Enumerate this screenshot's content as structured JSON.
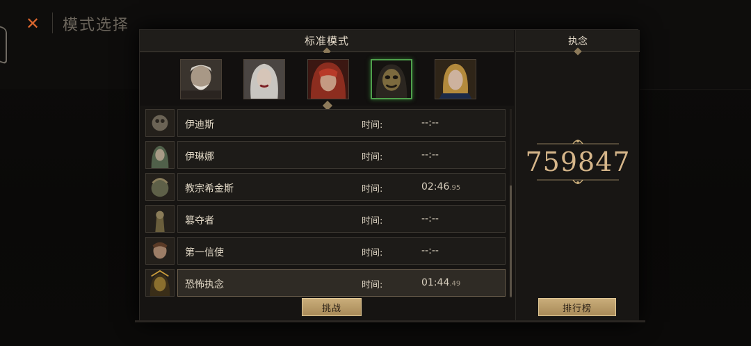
{
  "background": {
    "title": "模式选择",
    "close_icon": "close-icon"
  },
  "mode": {
    "title": "标准模式",
    "portraits": [
      {
        "name": "portrait-old-man",
        "selected": false
      },
      {
        "name": "portrait-silver-hair-woman",
        "selected": false
      },
      {
        "name": "portrait-red-hood-woman",
        "selected": false
      },
      {
        "name": "portrait-masked-figure",
        "selected": true
      },
      {
        "name": "portrait-blonde-woman",
        "selected": false
      }
    ],
    "bosses": [
      {
        "name": "伊迪斯",
        "time_label": "时间:",
        "time": "--:--",
        "ms": ""
      },
      {
        "name": "伊琳娜",
        "time_label": "时间:",
        "time": "--:--",
        "ms": ""
      },
      {
        "name": "教宗希金斯",
        "time_label": "时间:",
        "time": "02:46",
        "ms": ".95"
      },
      {
        "name": "篡夺者",
        "time_label": "时间:",
        "time": "--:--",
        "ms": ""
      },
      {
        "name": "第一信使",
        "time_label": "时间:",
        "time": "--:--",
        "ms": ""
      },
      {
        "name": "恐怖执念",
        "time_label": "时间:",
        "time": "01:44",
        "ms": ".49"
      }
    ],
    "challenge_label": "挑战"
  },
  "obsession": {
    "title": "执念",
    "score": "759847",
    "leaderboard_label": "排行榜"
  },
  "colors": {
    "accent_gold": "#d6b68a",
    "button_gold": "#c9ad7a",
    "selected_green": "#4fa04c",
    "close_orange": "#d9652e"
  }
}
